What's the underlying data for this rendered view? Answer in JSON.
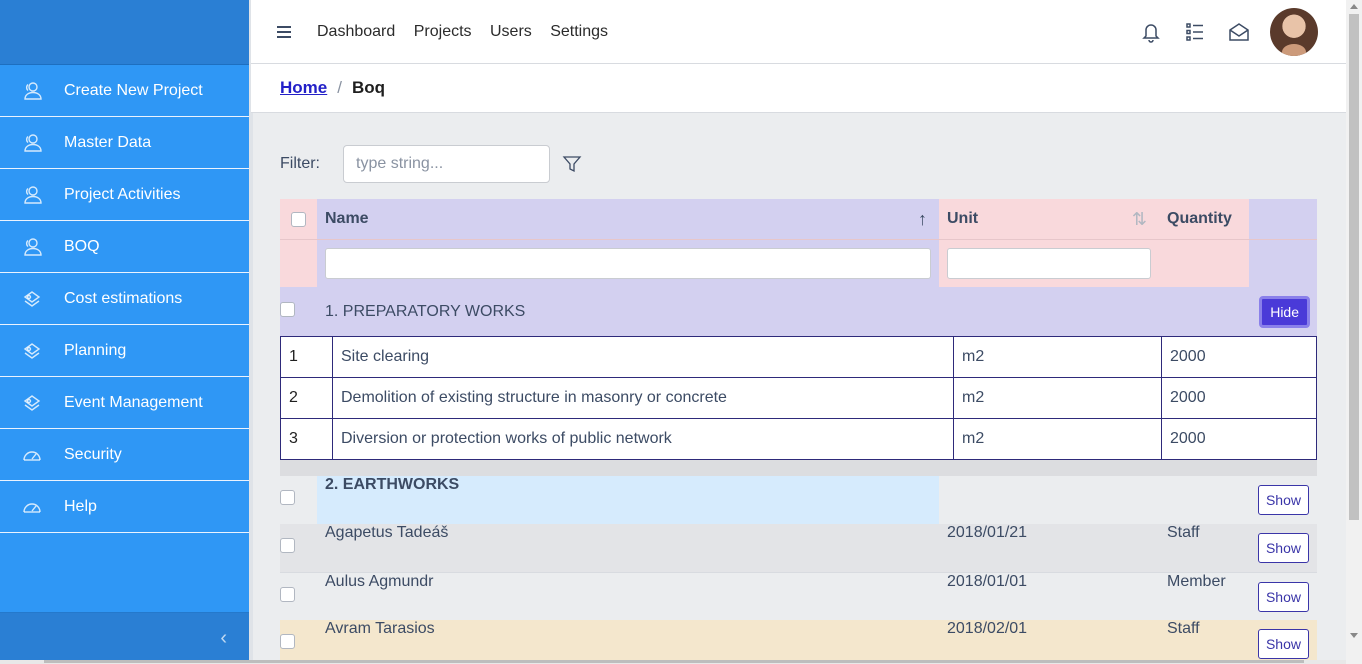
{
  "sidebar": {
    "items": [
      {
        "label": "Create New Project",
        "icon": "users-icon"
      },
      {
        "label": "Master Data",
        "icon": "users-icon"
      },
      {
        "label": "Project Activities",
        "icon": "users-icon"
      },
      {
        "label": "BOQ",
        "icon": "users-icon"
      },
      {
        "label": "Cost estimations",
        "icon": "puzzle-icon"
      },
      {
        "label": "Planning",
        "icon": "puzzle-icon"
      },
      {
        "label": "Event Management",
        "icon": "puzzle-icon"
      },
      {
        "label": "Security",
        "icon": "speedometer-icon"
      },
      {
        "label": "Help",
        "icon": "speedometer-icon"
      }
    ],
    "toggler": "‹"
  },
  "header": {
    "nav": [
      "Dashboard",
      "Projects",
      "Users",
      "Settings"
    ]
  },
  "breadcrumb": {
    "home": "Home",
    "current": "Boq"
  },
  "filter": {
    "label": "Filter:",
    "placeholder": "type string..."
  },
  "table": {
    "columns": {
      "name": "Name",
      "unit": "Unit",
      "quantity": "Quantity"
    },
    "groups": [
      {
        "title": "1. PREPARATORY WORKS",
        "button": "Hide",
        "items": [
          {
            "num": "1",
            "desc": "Site clearing",
            "unit": "m2",
            "qty": "2000"
          },
          {
            "num": "2",
            "desc": "Demolition of existing structure in masonry or concrete",
            "unit": "m2",
            "qty": "2000"
          },
          {
            "num": "3",
            "desc": "Diversion or protection works of public network",
            "unit": "m2",
            "qty": "2000"
          }
        ]
      },
      {
        "title": "2. EARTHWORKS",
        "button": "Show"
      }
    ],
    "rows": [
      {
        "name": "Agapetus Tadeáš",
        "date": "2018/01/21",
        "role": "Staff",
        "button": "Show"
      },
      {
        "name": "Aulus Agmundr",
        "date": "2018/01/01",
        "role": "Member",
        "button": "Show"
      },
      {
        "name": "Avram Tarasios",
        "date": "2018/02/01",
        "role": "Staff",
        "button": "Show"
      }
    ]
  },
  "colors": {
    "sidebar": "#2f97f5",
    "header_purple": "#d3d0f0",
    "header_pink": "#f9d9dc",
    "earthworks_blue": "#d6ebfd",
    "row_gray": "#e3e4e7",
    "row_light": "#ebedef",
    "row_beige": "#f4e7cd",
    "hide_button": "#4a3ad8"
  }
}
